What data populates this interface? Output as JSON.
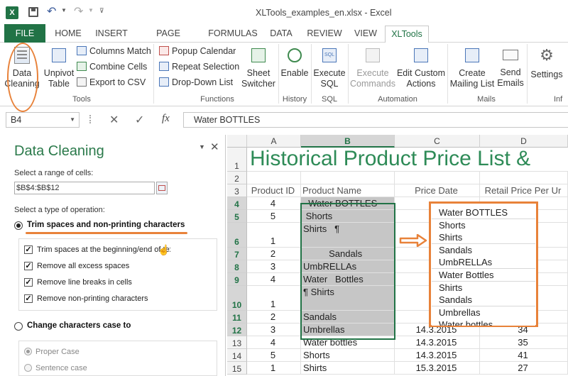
{
  "window": {
    "title": "XLTools_examples_en.xlsx - Excel"
  },
  "tabs": [
    "FILE",
    "HOME",
    "INSERT",
    "PAGE LAYOUT",
    "FORMULAS",
    "DATA",
    "REVIEW",
    "VIEW",
    "XLTools"
  ],
  "ribbon": {
    "data_cleaning": [
      "Data",
      "Cleaning"
    ],
    "unpivot": [
      "Unpivot",
      "Table"
    ],
    "columns_match": "Columns Match",
    "combine_cells": "Combine Cells",
    "export_csv": "Export to CSV",
    "popup_calendar": "Popup Calendar",
    "repeat_selection": "Repeat Selection",
    "dropdown_list": "Drop-Down List",
    "sheet_switcher": [
      "Sheet",
      "Switcher"
    ],
    "enable": "Enable",
    "execute_sql": [
      "Execute",
      "SQL"
    ],
    "execute_commands": [
      "Execute",
      "Commands"
    ],
    "edit_custom": [
      "Edit Custom",
      "Actions"
    ],
    "create_mailing": [
      "Create",
      "Mailing List"
    ],
    "send_emails": [
      "Send",
      "Emails"
    ],
    "settings": "Settings",
    "groups": {
      "tools": "Tools",
      "functions": "Functions",
      "history": "History",
      "sql": "SQL",
      "automation": "Automation",
      "mails": "Mails",
      "info": "Inf"
    }
  },
  "formula_bar": {
    "name_box": "B4",
    "cancel": "✕",
    "enter": "✓",
    "fx": "fx",
    "value": "Water BOTTLES"
  },
  "pane": {
    "title": "Data Cleaning",
    "range_label": "Select a range of cells:",
    "range_value": "$B$4:$B$12",
    "op_label": "Select a type of operation:",
    "trim_option": "Trim spaces and non-printing characters",
    "checks": [
      "Trim spaces at the beginning/end of text",
      "Remove all excess spaces",
      "Remove line breaks in cells",
      "Remove non-printing characters"
    ],
    "case_option": "Change characters case to",
    "case_options": [
      "Proper Case",
      "Sentence case"
    ]
  },
  "sheet": {
    "columns": [
      "A",
      "B",
      "C",
      "D"
    ],
    "title": "Historical Product Price List &",
    "headers": [
      "Product ID",
      "Product Name",
      "Price Date",
      "Retail Price Per Ur"
    ],
    "rows": [
      {
        "n": "4",
        "a": "4",
        "b": "  Water BOTTLES",
        "c": "",
        "d": ""
      },
      {
        "n": "5",
        "a": "5",
        "b": " Shorts",
        "c": "",
        "d": ""
      },
      {
        "n": "6",
        "a": "1",
        "b": "Shirts   ¶",
        "c": "",
        "d": ""
      },
      {
        "n": "7",
        "a": "2",
        "b": "          Sandals",
        "c": "",
        "d": ""
      },
      {
        "n": "8",
        "a": "3",
        "b": "UmbRELLAs",
        "c": "",
        "d": ""
      },
      {
        "n": "9",
        "a": "4",
        "b": "Water   Bottles",
        "c": "",
        "d": ""
      },
      {
        "n": "10",
        "a": "1",
        "b": "¶ Shirts",
        "c": "",
        "d": ""
      },
      {
        "n": "11",
        "a": "2",
        "b": "Sandals",
        "c": "",
        "d": ""
      },
      {
        "n": "12",
        "a": "3",
        "b": "Umbrellas",
        "c": "14.3.2015",
        "d": "34"
      },
      {
        "n": "13",
        "a": "4",
        "b": "Water bottles",
        "c": "14.3.2015",
        "d": "35"
      },
      {
        "n": "14",
        "a": "5",
        "b": "Shorts",
        "c": "14.3.2015",
        "d": "41"
      },
      {
        "n": "15",
        "a": "1",
        "b": "Shirts",
        "c": "15.3.2015",
        "d": "27"
      }
    ]
  },
  "result_list": [
    "Water BOTTLES",
    "Shorts",
    "Shirts",
    "Sandals",
    "UmbRELLAs",
    "Water Bottles",
    "Shirts",
    "Sandals",
    "Umbrellas",
    "Water bottles"
  ],
  "colors": {
    "excel_green": "#217346",
    "accent": "#e8823a",
    "title_green": "#2e8b57"
  }
}
